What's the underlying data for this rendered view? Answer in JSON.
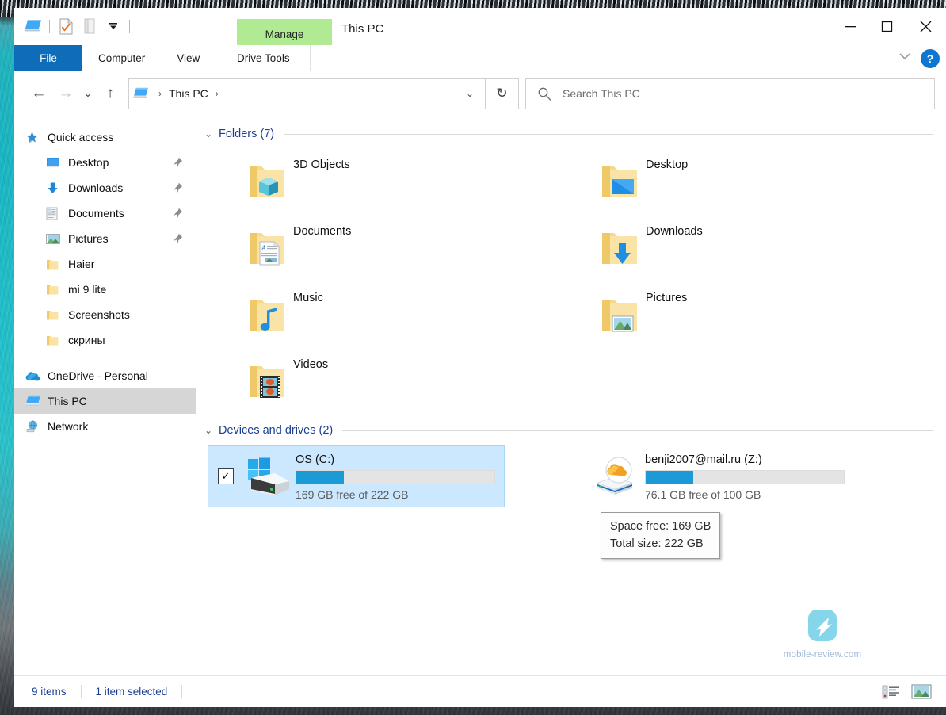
{
  "window": {
    "title": "This PC",
    "contextual_tab": "Manage",
    "quick_access_toolbar": [
      {
        "name": "this-pc-icon",
        "label": "This PC"
      },
      {
        "name": "properties-icon",
        "label": "Properties"
      },
      {
        "name": "new-folder-icon",
        "label": "New folder"
      },
      {
        "name": "customize-qat-icon",
        "label": "Customize Quick Access Toolbar"
      }
    ],
    "controls": {
      "minimize": "—",
      "maximize": "☐",
      "close": "✕"
    }
  },
  "ribbon": {
    "tabs": [
      {
        "label": "File",
        "active": true
      },
      {
        "label": "Computer",
        "active": false
      },
      {
        "label": "View",
        "active": false
      },
      {
        "label": "Drive Tools",
        "active": false
      }
    ],
    "collapse_label": "⌄",
    "help_label": "?"
  },
  "navigation": {
    "back": "←",
    "forward": "→",
    "recent": "⌄",
    "up": "↑",
    "refresh": "↻",
    "address_dropdown": "⌄",
    "breadcrumb": [
      {
        "label": "This PC"
      }
    ],
    "breadcrumb_separator": "›"
  },
  "search": {
    "placeholder": "Search This PC",
    "value": "",
    "icon": "search-icon"
  },
  "sidebar": {
    "items": [
      {
        "label": "Quick access",
        "icon": "star-pin-icon",
        "indent": false,
        "pinned": false,
        "selected": false
      },
      {
        "label": "Desktop",
        "icon": "desktop-icon",
        "indent": true,
        "pinned": true,
        "selected": false
      },
      {
        "label": "Downloads",
        "icon": "downloads-icon",
        "indent": true,
        "pinned": true,
        "selected": false
      },
      {
        "label": "Documents",
        "icon": "documents-icon",
        "indent": true,
        "pinned": true,
        "selected": false
      },
      {
        "label": "Pictures",
        "icon": "pictures-icon",
        "indent": true,
        "pinned": true,
        "selected": false
      },
      {
        "label": "Haier",
        "icon": "folder-icon",
        "indent": true,
        "pinned": false,
        "selected": false
      },
      {
        "label": "mi 9 lite",
        "icon": "folder-icon",
        "indent": true,
        "pinned": false,
        "selected": false
      },
      {
        "label": "Screenshots",
        "icon": "folder-icon",
        "indent": true,
        "pinned": false,
        "selected": false
      },
      {
        "label": "скрины",
        "icon": "folder-icon",
        "indent": true,
        "pinned": false,
        "selected": false
      },
      {
        "label": "OneDrive - Personal",
        "icon": "onedrive-icon",
        "indent": false,
        "pinned": false,
        "selected": false
      },
      {
        "label": "This PC",
        "icon": "this-pc-icon",
        "indent": false,
        "pinned": false,
        "selected": true
      },
      {
        "label": "Network",
        "icon": "network-icon",
        "indent": false,
        "pinned": false,
        "selected": false
      }
    ]
  },
  "main": {
    "folders_section": {
      "title": "Folders (7)",
      "chevron": "⌄",
      "items": [
        {
          "label": "3D Objects",
          "icon": "folder-3d-objects-icon"
        },
        {
          "label": "Desktop",
          "icon": "folder-desktop-icon"
        },
        {
          "label": "Documents",
          "icon": "folder-documents-icon"
        },
        {
          "label": "Downloads",
          "icon": "folder-downloads-icon"
        },
        {
          "label": "Music",
          "icon": "folder-music-icon"
        },
        {
          "label": "Pictures",
          "icon": "folder-pictures-icon"
        },
        {
          "label": "Videos",
          "icon": "folder-videos-icon"
        }
      ]
    },
    "drives_section": {
      "title": "Devices and drives (2)",
      "chevron": "⌄",
      "items": [
        {
          "name": "OS (C:)",
          "icon": "windows-hard-drive-icon",
          "free_text": "169 GB free of 222 GB",
          "free_gb": 169,
          "total_gb": 222,
          "used_percent": 24,
          "selected": true,
          "checkbox": "✓"
        },
        {
          "name": "benji2007@mail.ru (Z:)",
          "icon": "cloud-drive-icon",
          "free_text": "76.1 GB free of 100 GB",
          "free_gb": 76.1,
          "total_gb": 100,
          "used_percent": 24,
          "selected": false,
          "checkbox": ""
        }
      ]
    },
    "tooltip": {
      "line1": "Space free: 169 GB",
      "line2": "Total size: 222 GB"
    },
    "watermark": {
      "text": "mobile-review.com"
    }
  },
  "statusbar": {
    "item_count": "9 items",
    "selection": "1 item selected",
    "views": [
      {
        "name": "details-view-button",
        "active": false
      },
      {
        "name": "large-icons-view-button",
        "active": true
      }
    ]
  },
  "colors": {
    "accent_blue": "#0e6cb8",
    "manage_tab_green": "#b0eb93",
    "selection_blue": "#cce8ff",
    "progress_blue": "#1b9ad6",
    "section_header_blue": "#1b3f94",
    "help_blue": "#0e76d0"
  }
}
